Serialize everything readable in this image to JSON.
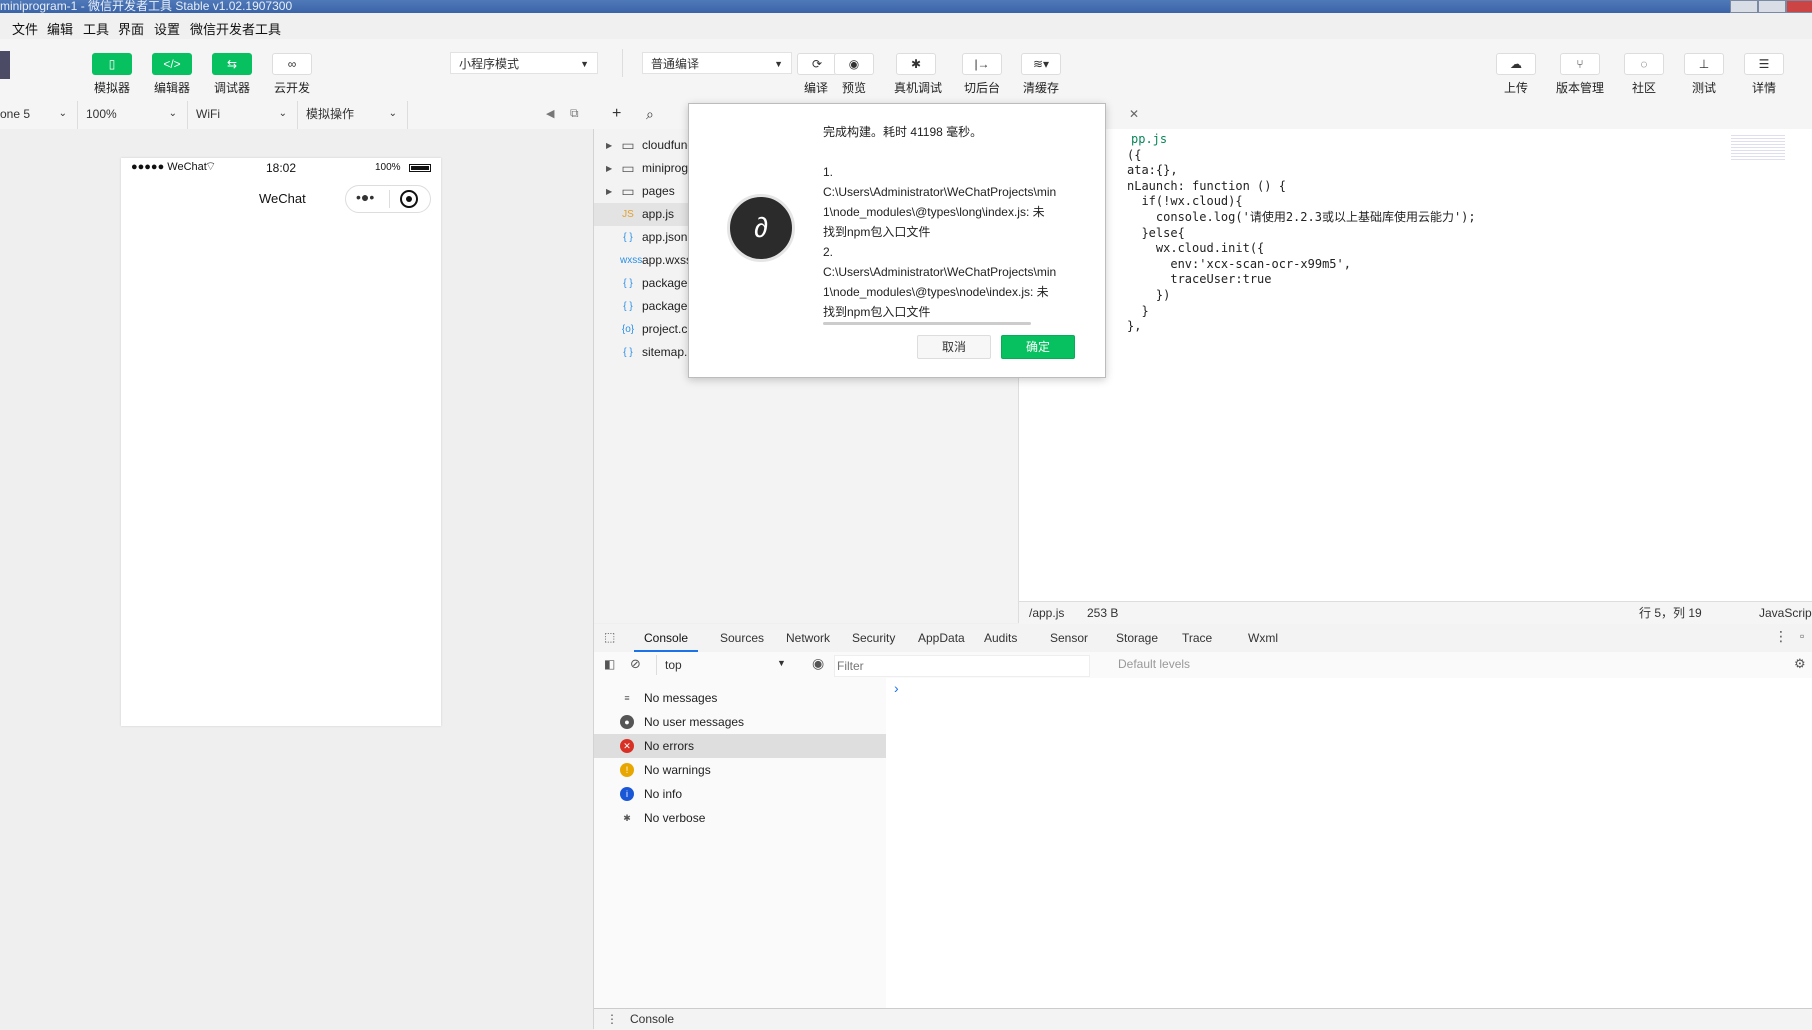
{
  "window": {
    "title": "miniprogram-1 - 微信开发者工具 Stable v1.02.1907300"
  },
  "menu": [
    "文件",
    "编辑",
    "工具",
    "界面",
    "设置",
    "微信开发者工具"
  ],
  "toolbar": {
    "simulator": "模拟器",
    "editor": "编辑器",
    "debugger": "调试器",
    "cloud": "云开发",
    "mode_select": "小程序模式",
    "compile_select": "普通编译",
    "compile": "编译",
    "preview": "预览",
    "real_debug": "真机调试",
    "background": "切后台",
    "clear_cache": "清缓存",
    "upload": "上传",
    "version": "版本管理",
    "community": "社区",
    "test": "测试",
    "details": "详情"
  },
  "sim": {
    "device": "one 5",
    "zoom": "100%",
    "network": "WiFi",
    "operation": "模拟操作",
    "status_signal": "●●●●● WeChat",
    "status_time": "18:02",
    "status_battery": "100%",
    "nav_title": "WeChat"
  },
  "tree": {
    "items": [
      {
        "name": "cloudfunc",
        "icon": "folder",
        "arrow": "▶"
      },
      {
        "name": "miniprogr",
        "icon": "folder",
        "arrow": "▶"
      },
      {
        "name": "pages",
        "icon": "folder",
        "arrow": "▶"
      },
      {
        "name": "app.js",
        "icon": "JS",
        "arrow": ""
      },
      {
        "name": "app.json",
        "icon": "{ }",
        "arrow": ""
      },
      {
        "name": "app.wxss",
        "icon": "wxss",
        "arrow": ""
      },
      {
        "name": "package",
        "icon": "{ }",
        "arrow": ""
      },
      {
        "name": "package",
        "icon": "{ }",
        "arrow": ""
      },
      {
        "name": "project.c",
        "icon": "{o}",
        "arrow": ""
      },
      {
        "name": "sitemap.",
        "icon": "{ }",
        "arrow": ""
      }
    ]
  },
  "editor": {
    "code": [
      "pp.js",
      "({",
      "ata:{},",
      "nLaunch: function () {",
      "  if(!wx.cloud){",
      "    console.log('请使用2.2.3或以上基础库使用云能力');",
      "  }else{",
      "    wx.cloud.init({",
      "      env:'xcx-scan-ocr-x99m5',",
      "      traceUser:true",
      "    })",
      "  }",
      "},"
    ],
    "status_path": "/app.js",
    "status_size": "253 B",
    "status_pos": "行 5，列 19",
    "status_lang": "JavaScrip"
  },
  "devtools": {
    "tabs": [
      "Console",
      "Sources",
      "Network",
      "Security",
      "AppData",
      "Audits",
      "Sensor",
      "Storage",
      "Trace",
      "Wxml"
    ],
    "context": "top",
    "filter_placeholder": "Filter",
    "levels": "Default levels",
    "sidebar": [
      {
        "label": "No messages",
        "icon": "list"
      },
      {
        "label": "No user messages",
        "icon": "user"
      },
      {
        "label": "No errors",
        "icon": "error"
      },
      {
        "label": "No warnings",
        "icon": "warning"
      },
      {
        "label": "No info",
        "icon": "info"
      },
      {
        "label": "No verbose",
        "icon": "verbose"
      }
    ],
    "prompt": "›",
    "bottom_tab": "Console"
  },
  "dialog": {
    "line1": "完成构建。耗时 41198 毫秒。",
    "line2": "1.",
    "line3": "C:\\Users\\Administrator\\WeChatProjects\\min",
    "line4": "1\\node_modules\\@types\\long\\index.js: 未",
    "line5": "找到npm包入口文件",
    "line6": "2.",
    "line7": "C:\\Users\\Administrator\\WeChatProjects\\min",
    "line8": "1\\node_modules\\@types\\node\\index.js: 未",
    "line9": "找到npm包入口文件",
    "cancel": "取消",
    "ok": "确定"
  },
  "colors": {
    "accent": "#07c160",
    "titlebar": "#3a64a8",
    "link": "#1a73e8"
  }
}
